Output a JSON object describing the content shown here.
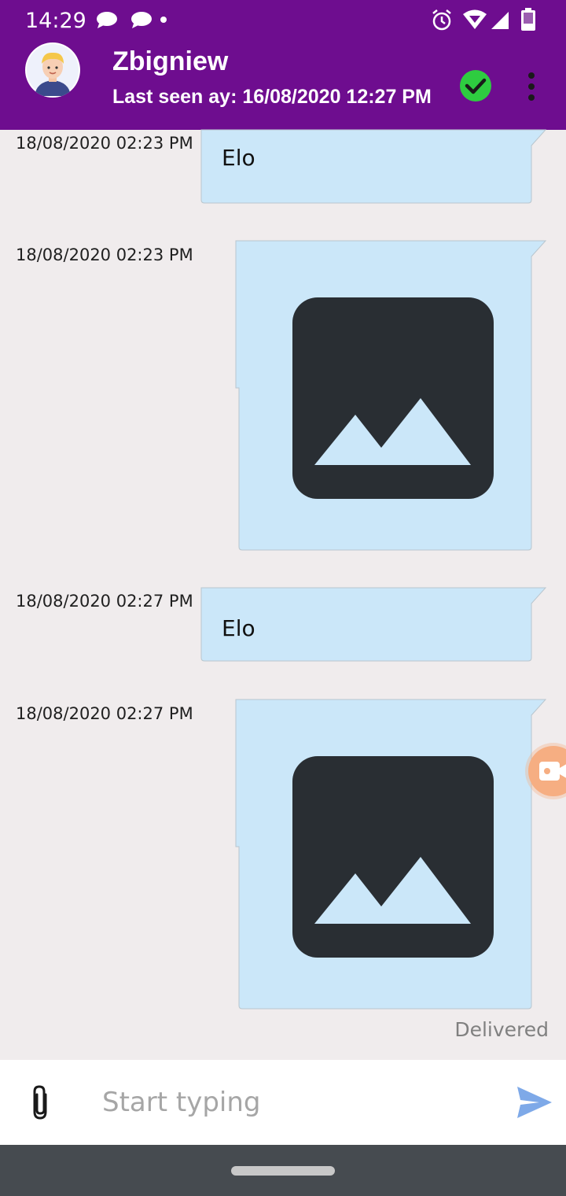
{
  "status_bar": {
    "time": "14:29",
    "notification_icons": [
      "chat-bubble-icon",
      "chat-bubble-icon",
      "dot-icon"
    ],
    "system_icons": [
      "alarm-icon",
      "wifi-icon",
      "signal-icon",
      "battery-icon"
    ]
  },
  "header": {
    "contact_name": "Zbigniew",
    "last_seen": "Last seen ay: 16/08/2020 12:27 PM",
    "online": true,
    "menu_icon": "more-vert-icon",
    "bar_color": "#6e0d8f"
  },
  "messages": [
    {
      "time": "18/08/2020 02:23 PM",
      "type": "text",
      "text": "Elo"
    },
    {
      "time": "18/08/2020 02:23 PM",
      "type": "image",
      "icon": "image-icon"
    },
    {
      "time": "18/08/2020 02:27 PM",
      "type": "text",
      "text": "Elo"
    },
    {
      "time": "18/08/2020 02:27 PM",
      "type": "image",
      "icon": "image-icon"
    }
  ],
  "delivery_status": "Delivered",
  "composer": {
    "placeholder": "Start typing",
    "value": "",
    "attach_icon": "paperclip-icon",
    "send_icon": "send-icon"
  },
  "colors": {
    "bubble": "#cbe7f9",
    "chat_background": "#f0eced",
    "send_accent": "#7ea9e8",
    "online_green": "#2ecc40"
  }
}
